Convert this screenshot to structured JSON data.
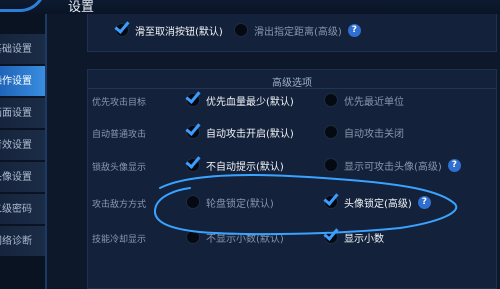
{
  "header": {
    "title": "设置"
  },
  "sidebar": {
    "items": [
      {
        "label": "基础设置",
        "active": false
      },
      {
        "label": "操作设置",
        "active": true
      },
      {
        "label": "画面设置",
        "active": false
      },
      {
        "label": "音效设置",
        "active": false
      },
      {
        "label": "头像设置",
        "active": false
      },
      {
        "label": "二级密码",
        "active": false
      },
      {
        "label": "网络诊断",
        "active": false
      }
    ]
  },
  "top_options": [
    {
      "label": "滑至取消按钮(默认)",
      "checked": true,
      "help": false
    },
    {
      "label": "滑出指定距离(高级)",
      "checked": false,
      "help": true
    }
  ],
  "advanced": {
    "title": "高级选项",
    "rows": [
      {
        "label": "优先攻击目标",
        "options": [
          {
            "label": "优先血量最少(默认)",
            "checked": true,
            "help": false
          },
          {
            "label": "优先最近单位",
            "checked": false,
            "help": false
          }
        ]
      },
      {
        "label": "自动普通攻击",
        "options": [
          {
            "label": "自动攻击开启(默认)",
            "checked": true,
            "help": false
          },
          {
            "label": "自动攻击关闭",
            "checked": false,
            "help": false
          }
        ]
      },
      {
        "label": "锁敌头像显示",
        "options": [
          {
            "label": "不自动提示(默认)",
            "checked": true,
            "help": false
          },
          {
            "label": "显示可攻击头像(高级)",
            "checked": false,
            "help": true
          }
        ]
      },
      {
        "label": "攻击敌方方式",
        "options": [
          {
            "label": "轮盘锁定(默认)",
            "checked": false,
            "help": false
          },
          {
            "label": "头像锁定(高级)",
            "checked": true,
            "help": true
          }
        ]
      },
      {
        "label": "技能冷却显示",
        "options": [
          {
            "label": "不显示小数(默认)",
            "checked": false,
            "help": false
          },
          {
            "label": "显示小数",
            "checked": true,
            "help": false
          }
        ]
      }
    ]
  },
  "help_glyph": "?",
  "colors": {
    "accent": "#3d9cff",
    "active_tab": "#2a78d0",
    "annotation_stroke": "#3aa3ff"
  }
}
